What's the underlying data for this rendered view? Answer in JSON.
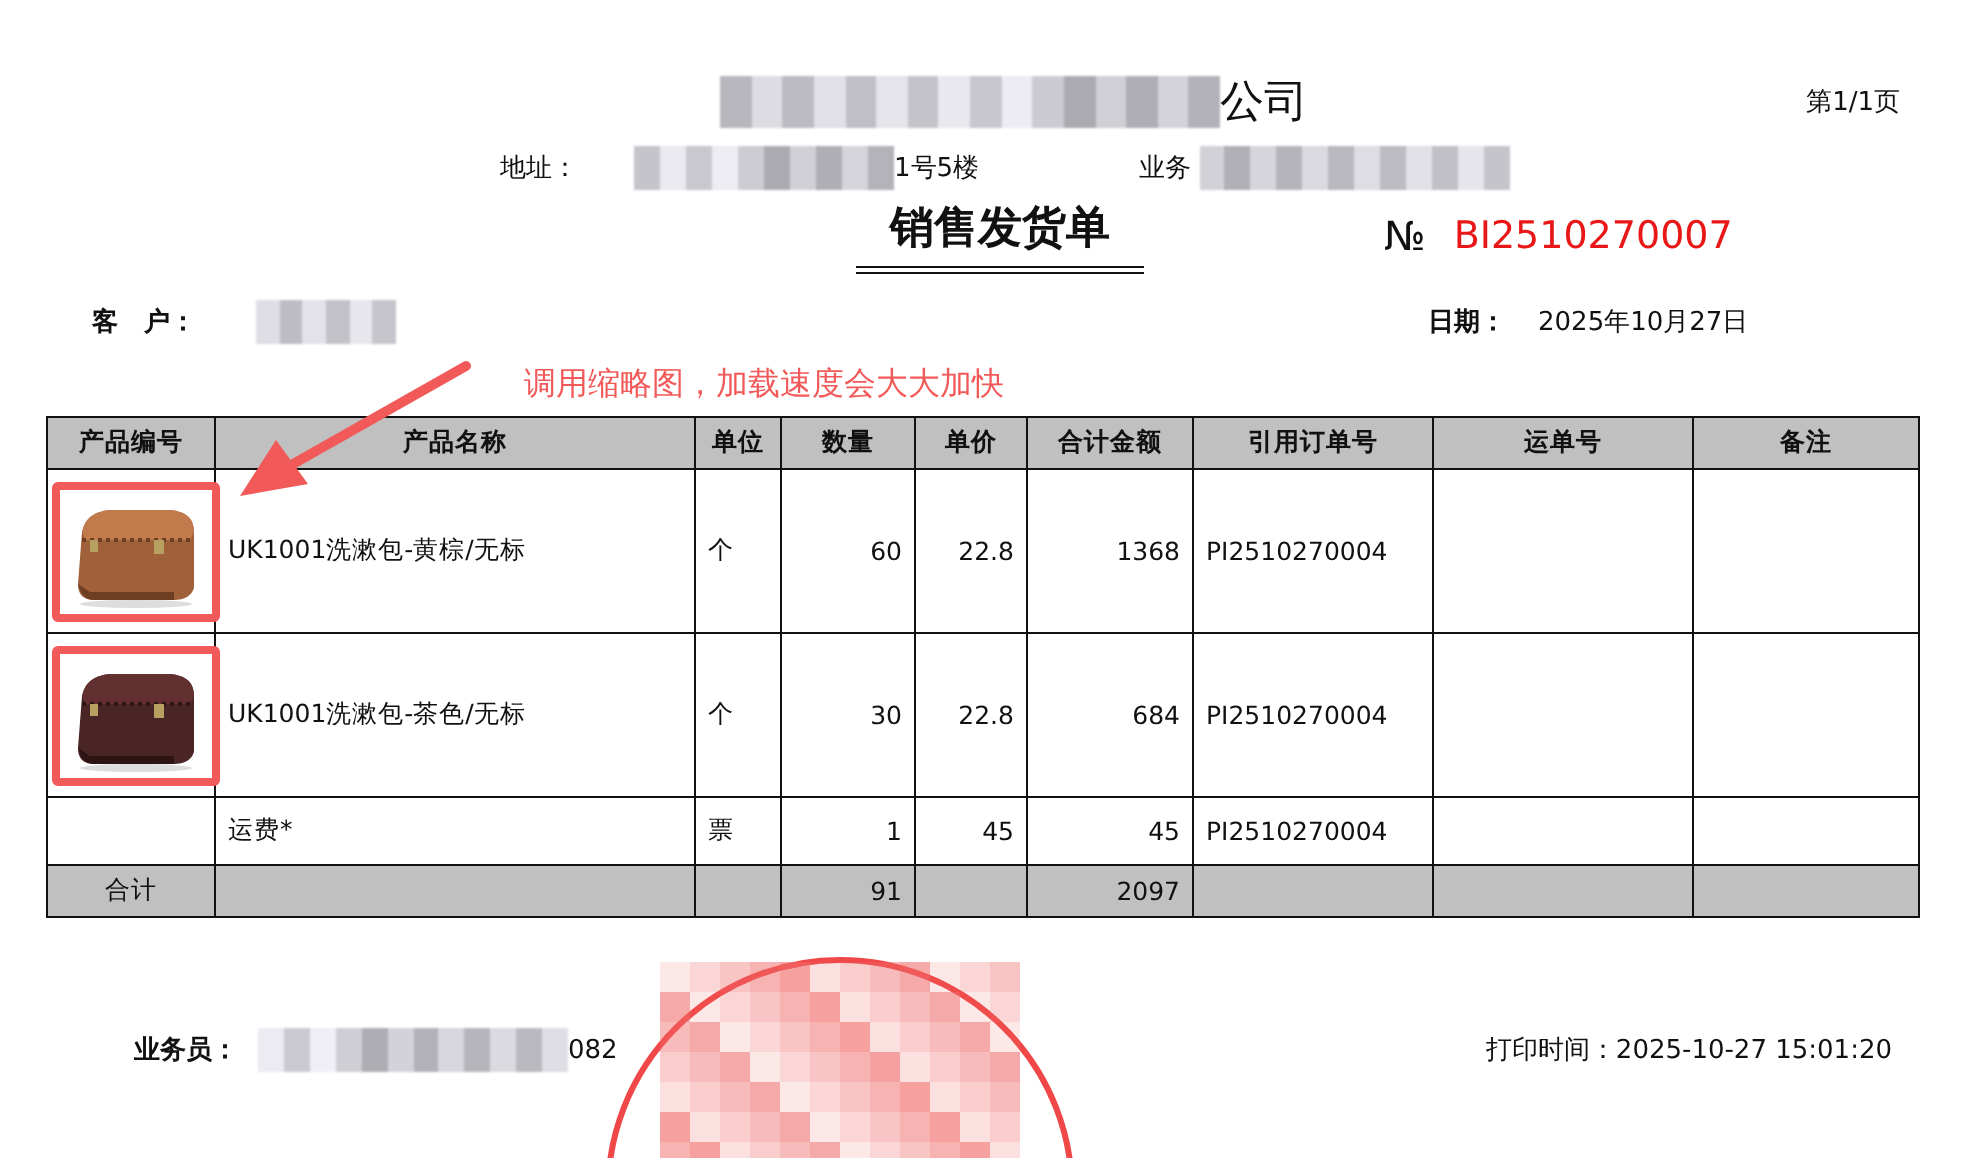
{
  "header": {
    "company_visible": "公司",
    "page_indicator": "第1/1页",
    "address_label": "地址：",
    "address_visible": "1号5楼",
    "contact_label_visible": "业务"
  },
  "title": "销售发货单",
  "number": {
    "symbol": "№",
    "value": "BI2510270007"
  },
  "customer": {
    "label": "客　户：",
    "date_label": "日期：",
    "date": "2025年10月27日"
  },
  "annotation": {
    "text": "调用缩略图，加载速度会大大加快"
  },
  "table": {
    "columns": [
      "产品编号",
      "产品名称",
      "单位",
      "数量",
      "单价",
      "合计金额",
      "引用订单号",
      "运单号",
      "备注"
    ],
    "rows": [
      {
        "thumbnail": {
          "kind": "picture",
          "annotated": true
        },
        "name": "UK1001洗漱包-黄棕/无标",
        "unit": "个",
        "qty": "60",
        "price": "22.8",
        "amount": "1368",
        "order": "PI2510270004"
      },
      {
        "thumbnail": {
          "kind": "picture",
          "annotated": true
        },
        "name": "UK1001洗漱包-茶色/无标",
        "unit": "个",
        "qty": "30",
        "price": "22.8",
        "amount": "684",
        "order": "PI2510270004"
      },
      {
        "name": "运费*",
        "unit": "票",
        "qty": "1",
        "price": "45",
        "amount": "45",
        "order": "PI2510270004"
      }
    ],
    "total": {
      "label": "合计",
      "qty": "91",
      "amount": "2097"
    }
  },
  "footer": {
    "salesperson_label": "业务员：",
    "salesperson_visible": "082",
    "print_time": "打印时间：2025-10-27 15:01:20"
  }
}
